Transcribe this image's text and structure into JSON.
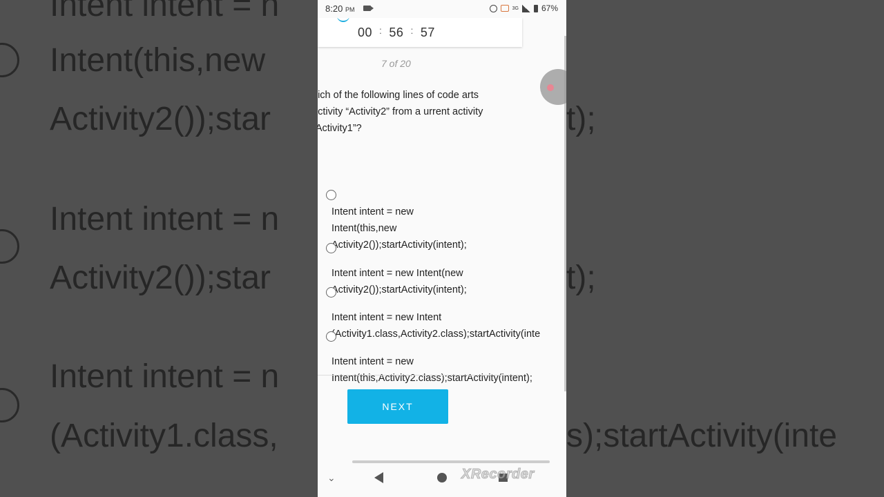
{
  "status_bar": {
    "time": "8:20",
    "ampm": "PM",
    "battery": "67%",
    "network": "3G"
  },
  "timer": {
    "hours": "00",
    "minutes": "56",
    "seconds": "57"
  },
  "counter": "7 of 20",
  "question": "hich of the following lines of code arts activity “Activity2” from a urrent activity “Activity1”?",
  "options": [
    {
      "label": "Intent intent = new\nIntent(this,new\nActivity2());startActivity(intent);"
    },
    {
      "label": "Intent intent = new Intent(new\nActivity2());startActivity(intent);"
    },
    {
      "label": "Intent intent = new Intent\n(Activity1.class,Activity2.class);startActivity(inte"
    },
    {
      "label": "Intent intent = new\nIntent(this,Activity2.class);startActivity(intent);"
    }
  ],
  "next_button": "NEXT",
  "watermark": "XRecorder",
  "background": {
    "lines": [
      "Intent intent = n",
      "Intent(this,new",
      "Activity2());star",
      "Intent intent = n",
      "Activity2());star",
      "Intent intent = n",
      "(Activity1.class,"
    ],
    "right_fragments": [
      "t);",
      "t);",
      "s);startActivity(inte"
    ]
  },
  "colors": {
    "accent": "#12b2e6",
    "background_dim": "#505050",
    "phone_bg": "#fafafa"
  }
}
